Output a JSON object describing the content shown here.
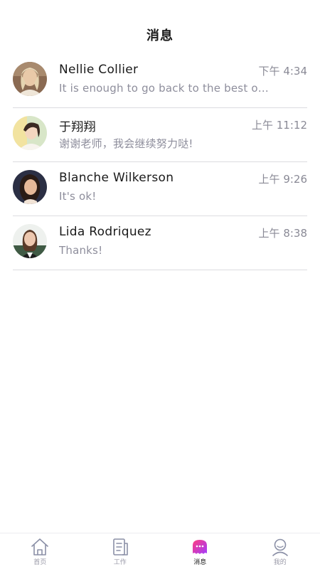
{
  "header": {
    "title": "消息"
  },
  "conversations": [
    {
      "name": "Nellie Collier",
      "time": "下午 4:34",
      "preview": "It is enough to go back to the best of ..."
    },
    {
      "name": "于翔翔",
      "time": "上午 11:12",
      "preview": "谢谢老师，我会继续努力哒!"
    },
    {
      "name": "Blanche Wilkerson",
      "time": "上午 9:26",
      "preview": "It's ok!"
    },
    {
      "name": "Lida Rodriquez",
      "time": "上午 8:38",
      "preview": "Thanks!"
    }
  ],
  "tabbar": {
    "home": "首页",
    "work": "工作",
    "messages": "消息",
    "mine": "我的"
  },
  "colors": {
    "accent_start": "#ff3d7f",
    "accent_end": "#a23cff",
    "inactive_icon": "#8a8fa6"
  }
}
